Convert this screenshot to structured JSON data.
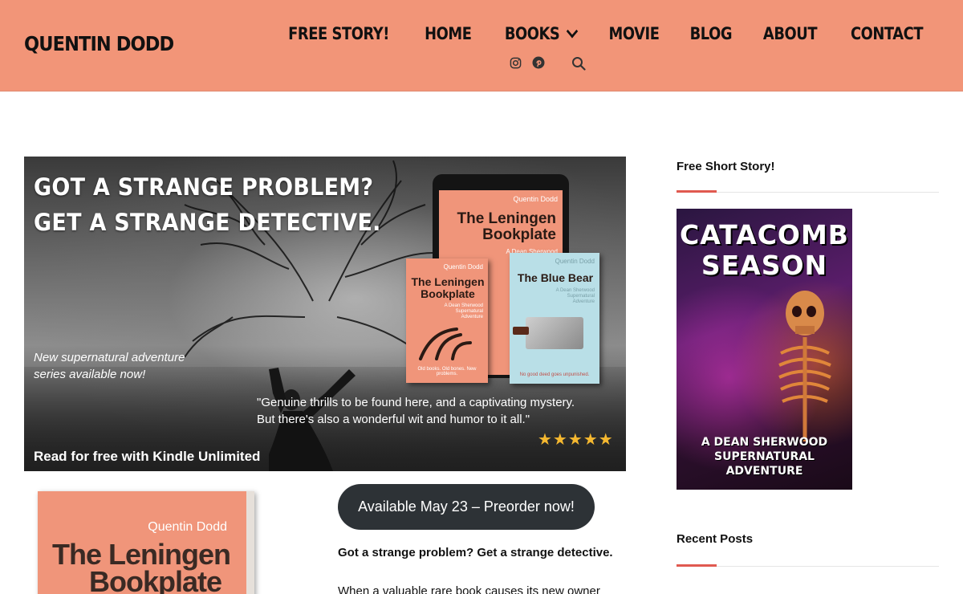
{
  "site": {
    "title": "QUENTIN DODD"
  },
  "nav": {
    "items": [
      "FREE STORY!",
      "HOME",
      "BOOKS",
      "MOVIE",
      "BLOG",
      "ABOUT",
      "CONTACT"
    ],
    "books_has_dropdown": true
  },
  "social": {
    "icons": [
      "instagram-icon",
      "pinterest-icon"
    ],
    "search": "search-icon"
  },
  "hero": {
    "headline_1": "GOT A STRANGE PROBLEM?",
    "headline_2": "GET A STRANGE DETECTIVE.",
    "sub_1": "New supernatural adventure",
    "sub_2": "series available now!",
    "quote_1": "\"Genuine thrills to be found here, and a captivating mystery.",
    "quote_2": "But there's also a wonderful wit and humor to it all.\"",
    "rating_stars": 5,
    "stars": "★★★★★",
    "kindle": "Read for free with Kindle Unlimited",
    "tablet_book": {
      "author": "Quentin Dodd",
      "title_1": "The Leningen",
      "title_2": "Bookplate",
      "sub": "A Dean Sherwood"
    },
    "book1": {
      "author": "Quentin Dodd",
      "title_1": "The Leningen",
      "title_2": "Bookplate",
      "sub_1": "A Dean Sherwood",
      "sub_2": "Supernatural",
      "sub_3": "Adventure",
      "bottom": "Old books. Old bones. New problems."
    },
    "book2": {
      "author": "Quentin Dodd",
      "title": "The Blue Bear",
      "sub_1": "A Dean Sherwood",
      "sub_2": "Supernatural",
      "sub_3": "Adventure",
      "bottom": "No good deed goes unpunished."
    }
  },
  "feature": {
    "book_author": "Quentin Dodd",
    "book_title_1": "The Leningen",
    "book_title_2": "Bookplate",
    "cta": "Available May 23 – Preorder now!",
    "tagline": "Got a strange problem? Get a strange detective.",
    "body": "When a valuable rare book causes its new owner"
  },
  "sidebar": {
    "widget1_title": "Free Short Story!",
    "free_book": {
      "title_1": "CATACOMB",
      "title_2": "SEASON",
      "sub_1": "A DEAN SHERWOOD",
      "sub_2": "SUPERNATURAL",
      "sub_3": "ADVENTURE"
    },
    "widget2_title": "Recent Posts"
  },
  "colors": {
    "header_bg": "#f29578",
    "cta_bg": "#2d3236",
    "accent": "#e05a50",
    "stars": "#f5b830"
  }
}
